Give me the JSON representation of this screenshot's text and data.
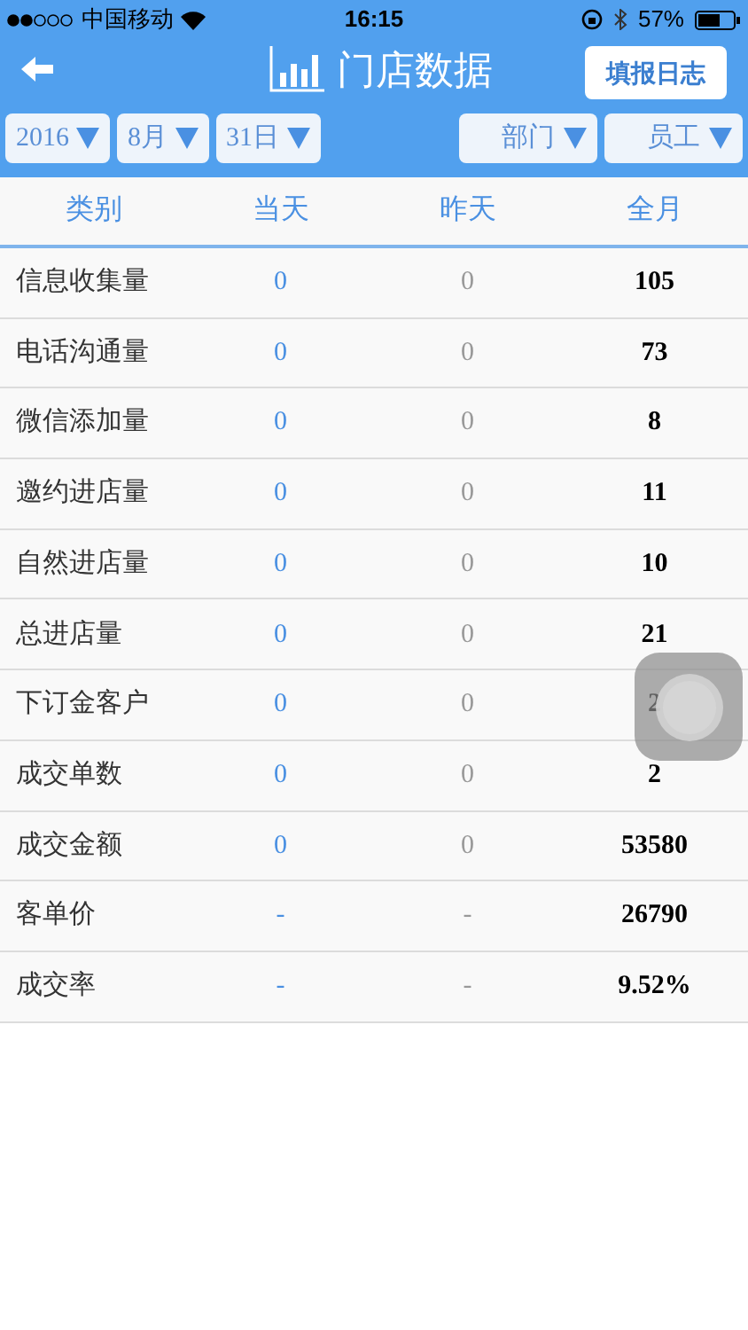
{
  "status_bar": {
    "carrier": "中国移动",
    "time": "16:15",
    "battery": "57%"
  },
  "header": {
    "title": "门店数据",
    "action": "填报日志"
  },
  "date_filters": [
    "2016",
    "8月",
    "31日"
  ],
  "group_filters": [
    "部门",
    "员工"
  ],
  "table": {
    "columns": [
      "类别",
      "当天",
      "昨天",
      "全月"
    ],
    "rows": [
      [
        "信息收集量",
        "0",
        "0",
        "105"
      ],
      [
        "电话沟通量",
        "0",
        "0",
        "73"
      ],
      [
        "微信添加量",
        "0",
        "0",
        "8"
      ],
      [
        "邀约进店量",
        "0",
        "0",
        "11"
      ],
      [
        "自然进店量",
        "0",
        "0",
        "10"
      ],
      [
        "总进店量",
        "0",
        "0",
        "21"
      ],
      [
        "下订金客户",
        "0",
        "0",
        "2"
      ],
      [
        "成交单数",
        "0",
        "0",
        "2"
      ],
      [
        "成交金额",
        "0",
        "0",
        "53580"
      ],
      [
        "客单价",
        "-",
        "-",
        "26790"
      ],
      [
        "成交率",
        "-",
        "-",
        "9.52%"
      ]
    ]
  }
}
